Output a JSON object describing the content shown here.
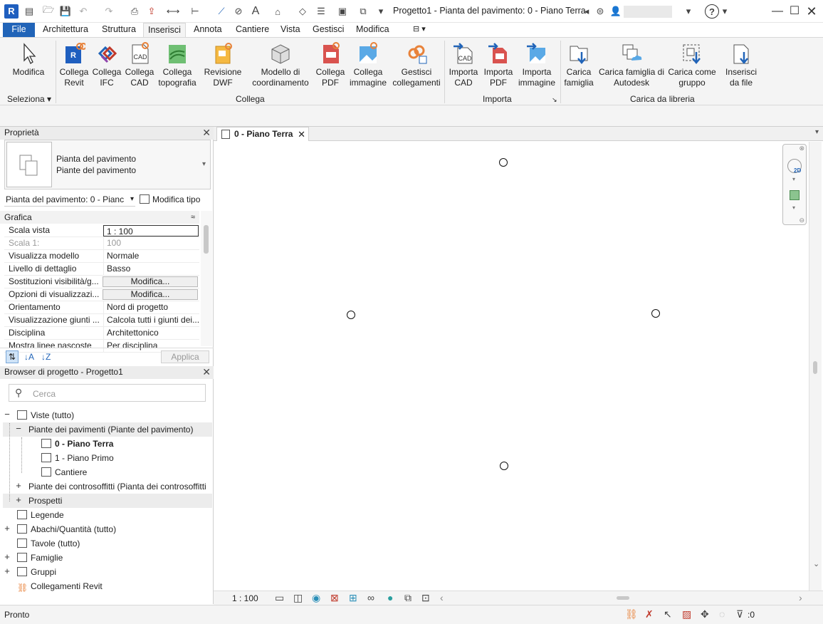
{
  "titlebar": {
    "app_logo": "R",
    "title": "Progetto1 - Pianta del pavimento: 0 - Piano Terra",
    "help": "?",
    "icons": [
      "new-icon",
      "open-icon",
      "save-icon",
      "undo-icon",
      "redo-icon",
      "print-icon",
      "export-icon",
      "measure-icon",
      "align-dimension-icon",
      "tag-icon",
      "text-icon",
      "3d-view-icon",
      "section-icon",
      "thin-lines-icon",
      "close-hidden-icon",
      "switch-windows-icon",
      "binoculars-icon",
      "user-icon"
    ]
  },
  "tabs": {
    "file": "File",
    "architettura": "Architettura",
    "struttura": "Struttura",
    "inserisci": "Inserisci",
    "annota": "Annota",
    "cantiere": "Cantiere",
    "vista": "Vista",
    "gestisci": "Gestisci",
    "modifica": "Modifica"
  },
  "ribbon": {
    "modifica": "Modifica",
    "collega_revit": [
      "Collega",
      "Revit"
    ],
    "collega_ifc": [
      "Collega",
      "IFC"
    ],
    "collega_cad": [
      "Collega",
      "CAD"
    ],
    "collega_topografia": [
      "Collega",
      "topografia"
    ],
    "revisione_dwf": [
      "Revisione",
      "DWF"
    ],
    "modello_coordinamento": [
      "Modello di",
      "coordinamento"
    ],
    "collega_pdf": [
      "Collega",
      "PDF"
    ],
    "collega_immagine": [
      "Collega",
      "immagine"
    ],
    "gestisci_collegamenti": [
      "Gestisci",
      "collegamenti"
    ],
    "importa_cad": [
      "Importa",
      "CAD"
    ],
    "importa_pdf": [
      "Importa",
      "PDF"
    ],
    "importa_immagine": [
      "Importa",
      "immagine"
    ],
    "carica_famiglia": [
      "Carica",
      "famiglia"
    ],
    "carica_famiglia_autodesk": [
      "Carica famiglia di",
      "Autodesk"
    ],
    "carica_come_gruppo": [
      "Carica come",
      "gruppo"
    ],
    "inserisci_da_file": [
      "Inserisci",
      "da file"
    ],
    "panels": {
      "seleziona": "Seleziona",
      "collega": "Collega",
      "importa": "Importa",
      "carica_libreria": "Carica da libreria"
    }
  },
  "properties": {
    "title": "Proprietà",
    "type_line1": "Pianta del pavimento",
    "type_line2": "Piante del pavimento",
    "selector": "Pianta del pavimento: 0 - Pianc",
    "edit_type": "Modifica tipo",
    "group": "Grafica",
    "rows": [
      {
        "name": "Scala vista",
        "value": "1 : 100"
      },
      {
        "name": "Scala  1:",
        "value": "100"
      },
      {
        "name": "Visualizza modello",
        "value": "Normale"
      },
      {
        "name": "Livello di dettaglio",
        "value": "Basso"
      },
      {
        "name": "Sostituzioni visibilità/g...",
        "value": "Modifica..."
      },
      {
        "name": "Opzioni di visualizzazi...",
        "value": "Modifica..."
      },
      {
        "name": "Orientamento",
        "value": "Nord di progetto"
      },
      {
        "name": "Visualizzazione giunti ...",
        "value": "Calcola tutti i giunti dei..."
      },
      {
        "name": "Disciplina",
        "value": "Architettonico"
      },
      {
        "name": "Mostra linee nascoste",
        "value": "Per disciplina"
      }
    ],
    "apply": "Applica"
  },
  "browser": {
    "title": "Browser di progetto - Progetto1",
    "search_placeholder": "Cerca",
    "items": [
      {
        "label": "Viste (tutto)",
        "toggle": "−"
      },
      {
        "label": "Piante dei pavimenti (Piante del pavimento)",
        "toggle": "−"
      },
      {
        "label": "0 - Piano Terra",
        "toggle": ""
      },
      {
        "label": "1 - Piano Primo",
        "toggle": ""
      },
      {
        "label": "Cantiere",
        "toggle": ""
      },
      {
        "label": "Piante dei controsoffitti (Pianta dei controsoffitti",
        "toggle": "+"
      },
      {
        "label": "Prospetti",
        "toggle": "+"
      },
      {
        "label": "Legende",
        "toggle": ""
      },
      {
        "label": "Abachi/Quantità (tutto)",
        "toggle": "+"
      },
      {
        "label": "Tavole (tutto)",
        "toggle": ""
      },
      {
        "label": "Famiglie",
        "toggle": "+"
      },
      {
        "label": "Gruppi",
        "toggle": "+"
      },
      {
        "label": "Collegamenti Revit",
        "toggle": ""
      }
    ]
  },
  "view": {
    "tab_label": "0 - Piano Terra",
    "scale": "1 : 100",
    "viewcube_label": "2D"
  },
  "status": {
    "text": "Pronto",
    "filter_count": ":0"
  },
  "colors": {
    "accent": "#2164b8",
    "ribbon_bg": "#f4f4f4",
    "link_orange": "#e8823a"
  }
}
